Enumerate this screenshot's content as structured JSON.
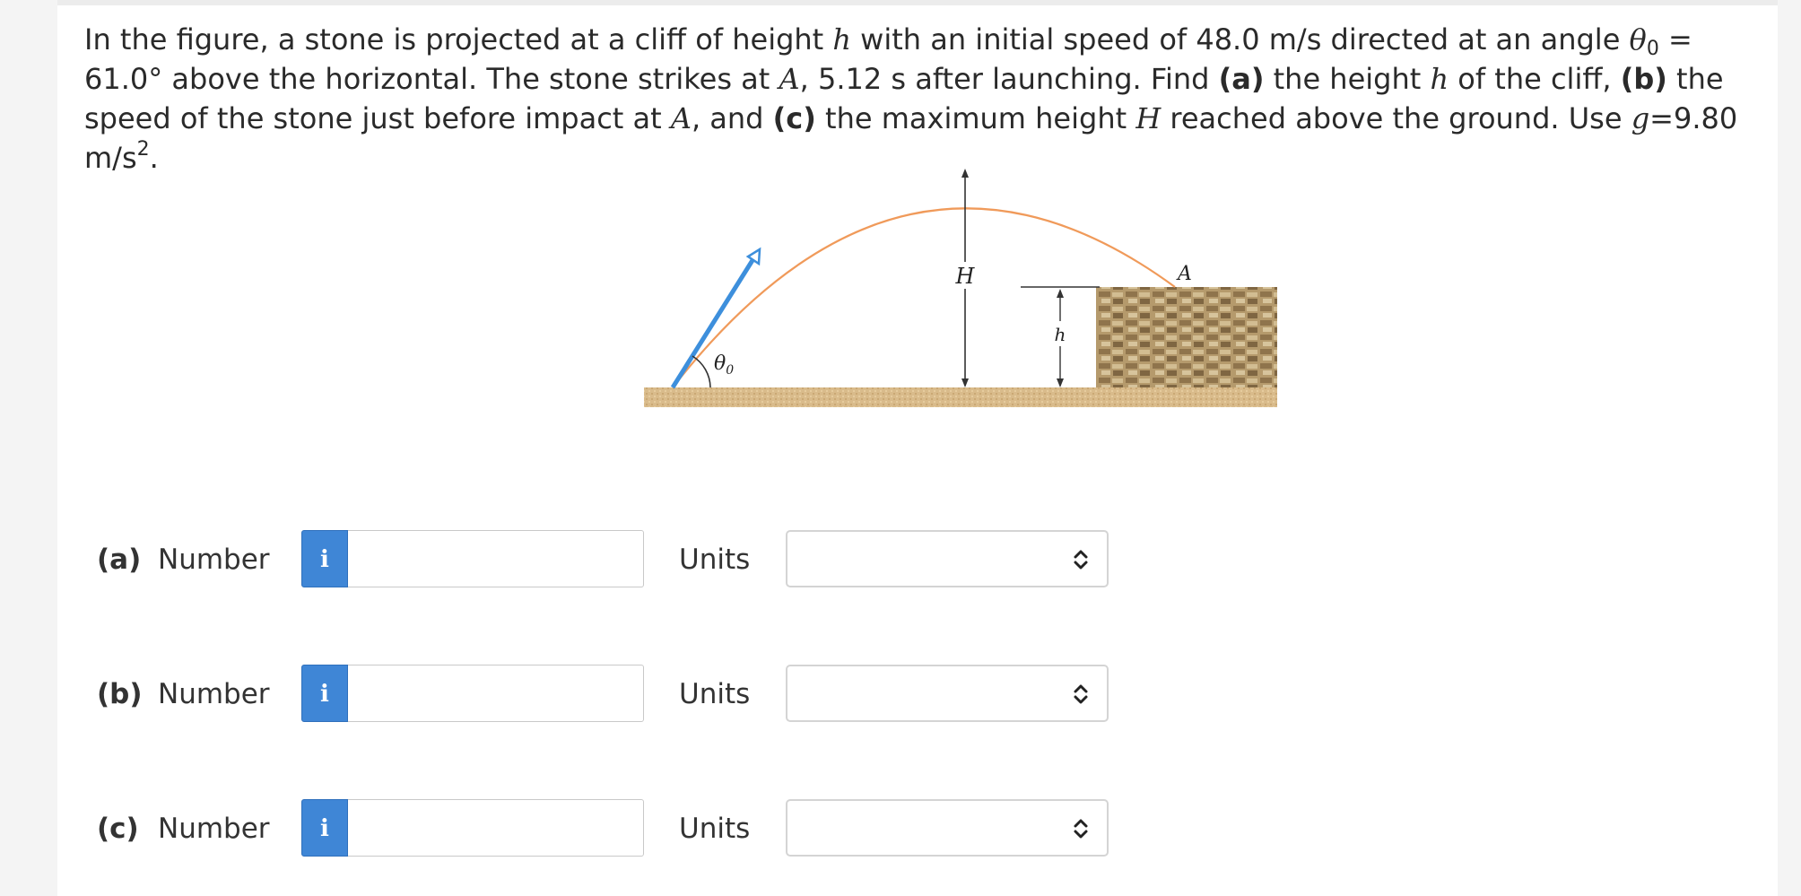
{
  "question": {
    "t1": "In the figure, a stone is projected at a cliff of height ",
    "h1": "h",
    "t2": " with an initial speed of 48.0 m/s directed at an angle ",
    "theta": "θ",
    "theta_sub": "0",
    "t3": " = 61.0° above the horizontal. The stone strikes at ",
    "A1": "A",
    "t4": ", 5.12 s after launching. Find ",
    "pa": "(a)",
    "t5": " the height ",
    "h2": "h",
    "t6": " of the cliff, ",
    "pb": "(b)",
    "t7": " the speed of the stone just before impact at ",
    "A2": "A",
    "t8": ", and ",
    "pc": "(c)",
    "t9": " the maximum height ",
    "H": "H",
    "t10": " reached above the ground. Use ",
    "g": "g",
    "t11": "=9.80 m/s",
    "sq": "2",
    "t12": "."
  },
  "figure": {
    "label_H": "H",
    "label_A": "A",
    "label_h": "h",
    "label_theta": "θ",
    "label_theta_sub": "0",
    "colors": {
      "trajectory": "#f09a5a",
      "velocity_arrow": "#3d8fdc",
      "ground": "#d8b987",
      "cliff": "#a88a5e"
    }
  },
  "parts": [
    {
      "label": "(a)",
      "number_label": "Number",
      "info_icon": "i",
      "number_value": "",
      "units_label": "Units",
      "units_value": ""
    },
    {
      "label": "(b)",
      "number_label": "Number",
      "info_icon": "i",
      "number_value": "",
      "units_label": "Units",
      "units_value": ""
    },
    {
      "label": "(c)",
      "number_label": "Number",
      "info_icon": "i",
      "number_value": "",
      "units_label": "Units",
      "units_value": ""
    }
  ]
}
